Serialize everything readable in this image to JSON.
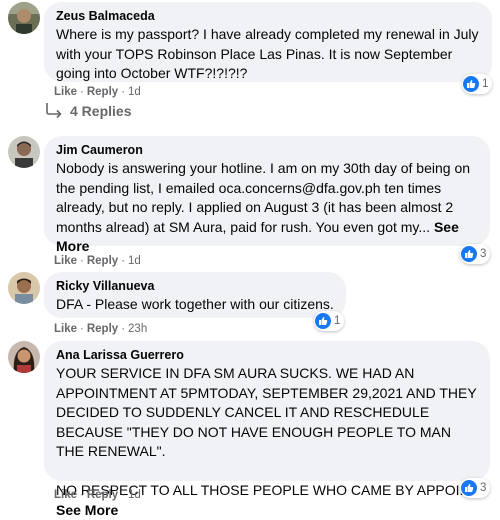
{
  "comments": [
    {
      "name": "Zeus Balmaceda",
      "text": "Where is my passport? I have already completed my renewal in July with your TOPS Robinson Place Las Pinas. It is now September going into October WTF?!?!?!?",
      "see_more": "",
      "like": "Like",
      "reply": "Reply",
      "time": "1d",
      "reactions": "1",
      "replies": "4 Replies"
    },
    {
      "name": "Jim Caumeron",
      "text": "Nobody is answering your hotline. I am on my 30th day of being on the pending list, I emailed oca.concerns@dfa.gov.ph ten times already, but no reply. I applied on August 3 (it has been almost 2 months alread) at SM Aura, paid for rush. You even got my...",
      "see_more": "See More",
      "like": "Like",
      "reply": "Reply",
      "time": "1d",
      "reactions": "3"
    },
    {
      "name": "Ricky Villanueva",
      "text": "DFA - Please work together with our citizens.",
      "see_more": "",
      "like": "Like",
      "reply": "Reply",
      "time": "23h",
      "reactions": "1"
    },
    {
      "name": "Ana Larissa Guerrero",
      "text": "YOUR SERVICE IN DFA SM AURA SUCKS. WE HAD AN APPOINTMENT AT 5PMTODAY, SEPTEMBER 29,2021 AND THEY DECIDED TO SUDDENLY CANCEL IT AND RESCHEDULE BECAUSE \"THEY DO NOT HAVE ENOUGH PEOPLE TO MAN THE RENEWAL\".\n\nNO RESPECT TO ALL THOSE PEOPLE WHO CAME BY APPOI...",
      "see_more": "See More",
      "like": "Like",
      "reply": "Reply",
      "time": "1d",
      "reactions": "3"
    }
  ],
  "colors": {
    "bubble": "#f0f2f5",
    "meta": "#65676b",
    "like_blue": "#1877f2"
  },
  "icons": {
    "reaction": "like-thumb-icon",
    "replies": "reply-arrow-icon"
  }
}
